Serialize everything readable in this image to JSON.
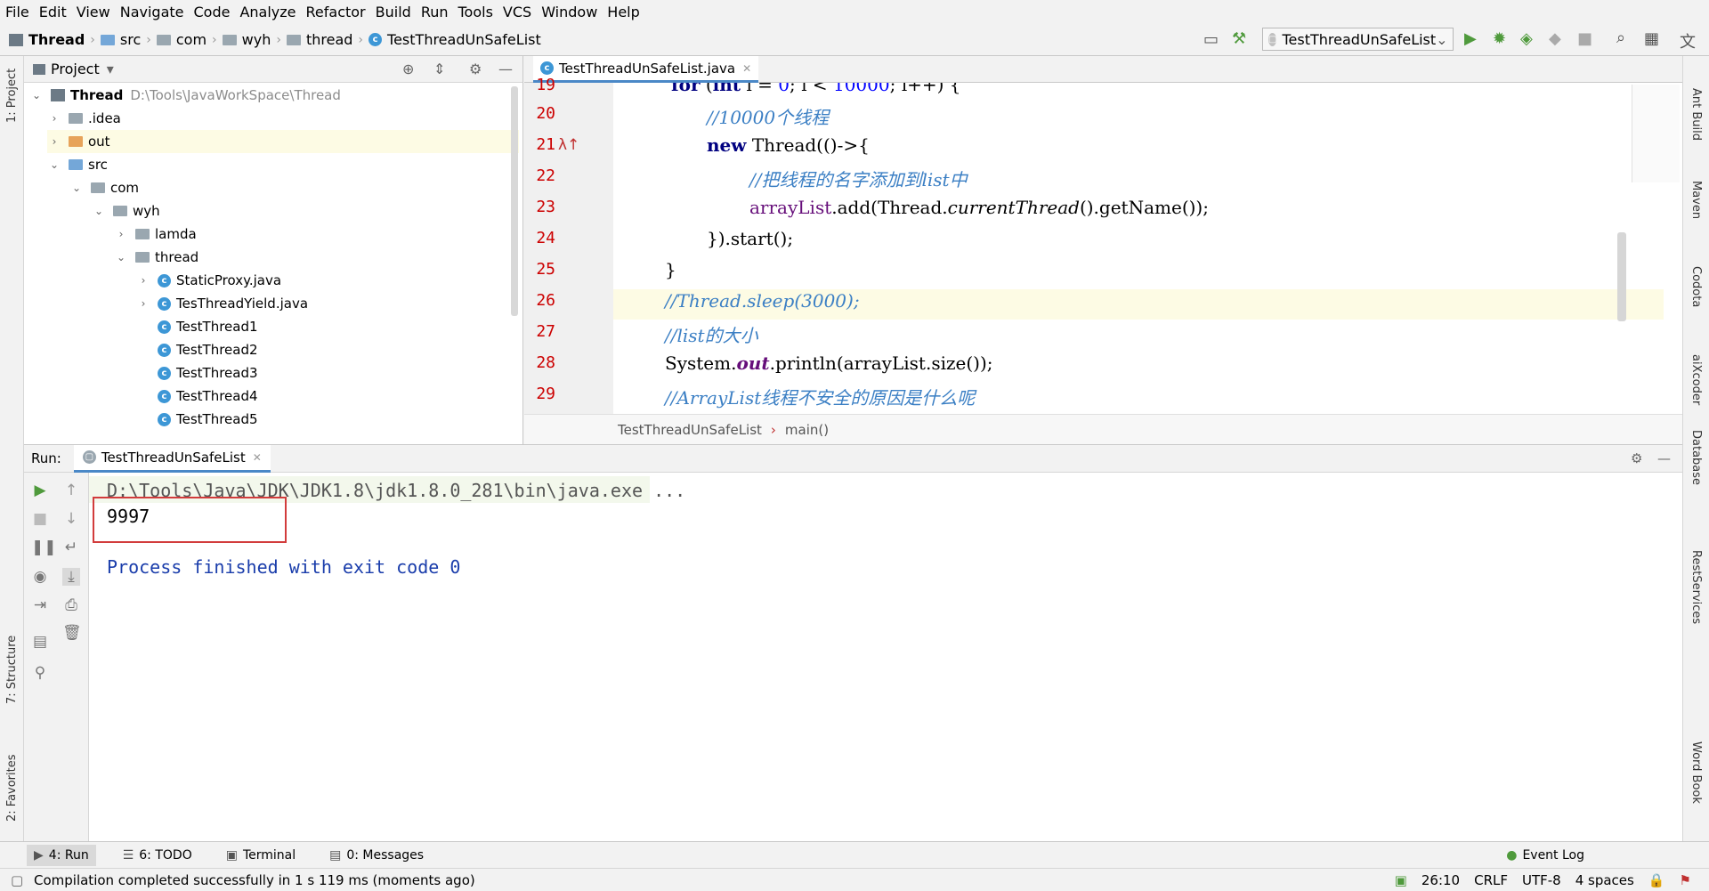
{
  "menu": [
    "File",
    "Edit",
    "View",
    "Navigate",
    "Code",
    "Analyze",
    "Refactor",
    "Build",
    "Run",
    "Tools",
    "VCS",
    "Window",
    "Help"
  ],
  "breadcrumb": [
    "Thread",
    "src",
    "com",
    "wyh",
    "thread",
    "TestThreadUnSafeList"
  ],
  "run_config": "TestThreadUnSafeList",
  "project_panel": {
    "title": "Project",
    "root_name": "Thread",
    "root_path": "D:\\Tools\\JavaWorkSpace\\Thread",
    "items": [
      ".idea",
      "out",
      "src",
      "com",
      "wyh",
      "lamda",
      "thread",
      "StaticProxy.java",
      "TesThreadYield.java",
      "TestThread1",
      "TestThread2",
      "TestThread3",
      "TestThread4",
      "TestThread5"
    ]
  },
  "editor": {
    "tab_label": "TestThreadUnSafeList.java",
    "line_numbers": [
      "19",
      "20",
      "21",
      "22",
      "23",
      "24",
      "25",
      "26",
      "27",
      "28",
      "29"
    ],
    "crumb_class": "TestThreadUnSafeList",
    "crumb_method": "main()"
  },
  "run_panel": {
    "label": "Run:",
    "tab_label": "TestThreadUnSafeList",
    "cmd_line": "D:\\Tools\\Java\\JDK\\JDK1.8\\jdk1.8.0_281\\bin\\java.exe ...",
    "output_value": "9997",
    "exit_message": "Process finished with exit code 0"
  },
  "left_strip": [
    "1: Project",
    "7: Structure",
    "2: Favorites"
  ],
  "right_strip": [
    "Ant Build",
    "Maven",
    "Codota",
    "aiXcoder",
    "Database",
    "RestServices",
    "Word Book"
  ],
  "bottom_tabs": [
    "4: Run",
    "6: TODO",
    "Terminal",
    "0: Messages"
  ],
  "event_log": "Event Log",
  "status": {
    "message": "Compilation completed successfully in 1 s 119 ms (moments ago)",
    "position": "26:10",
    "line_sep": "CRLF",
    "encoding": "UTF-8",
    "indent": "4 spaces"
  },
  "colors": {
    "accent": "#4a88c7",
    "line_number": "#cc0000",
    "keyword": "#000080",
    "comment": "#3b7fc4",
    "highlight_box": "#d23c3c"
  }
}
